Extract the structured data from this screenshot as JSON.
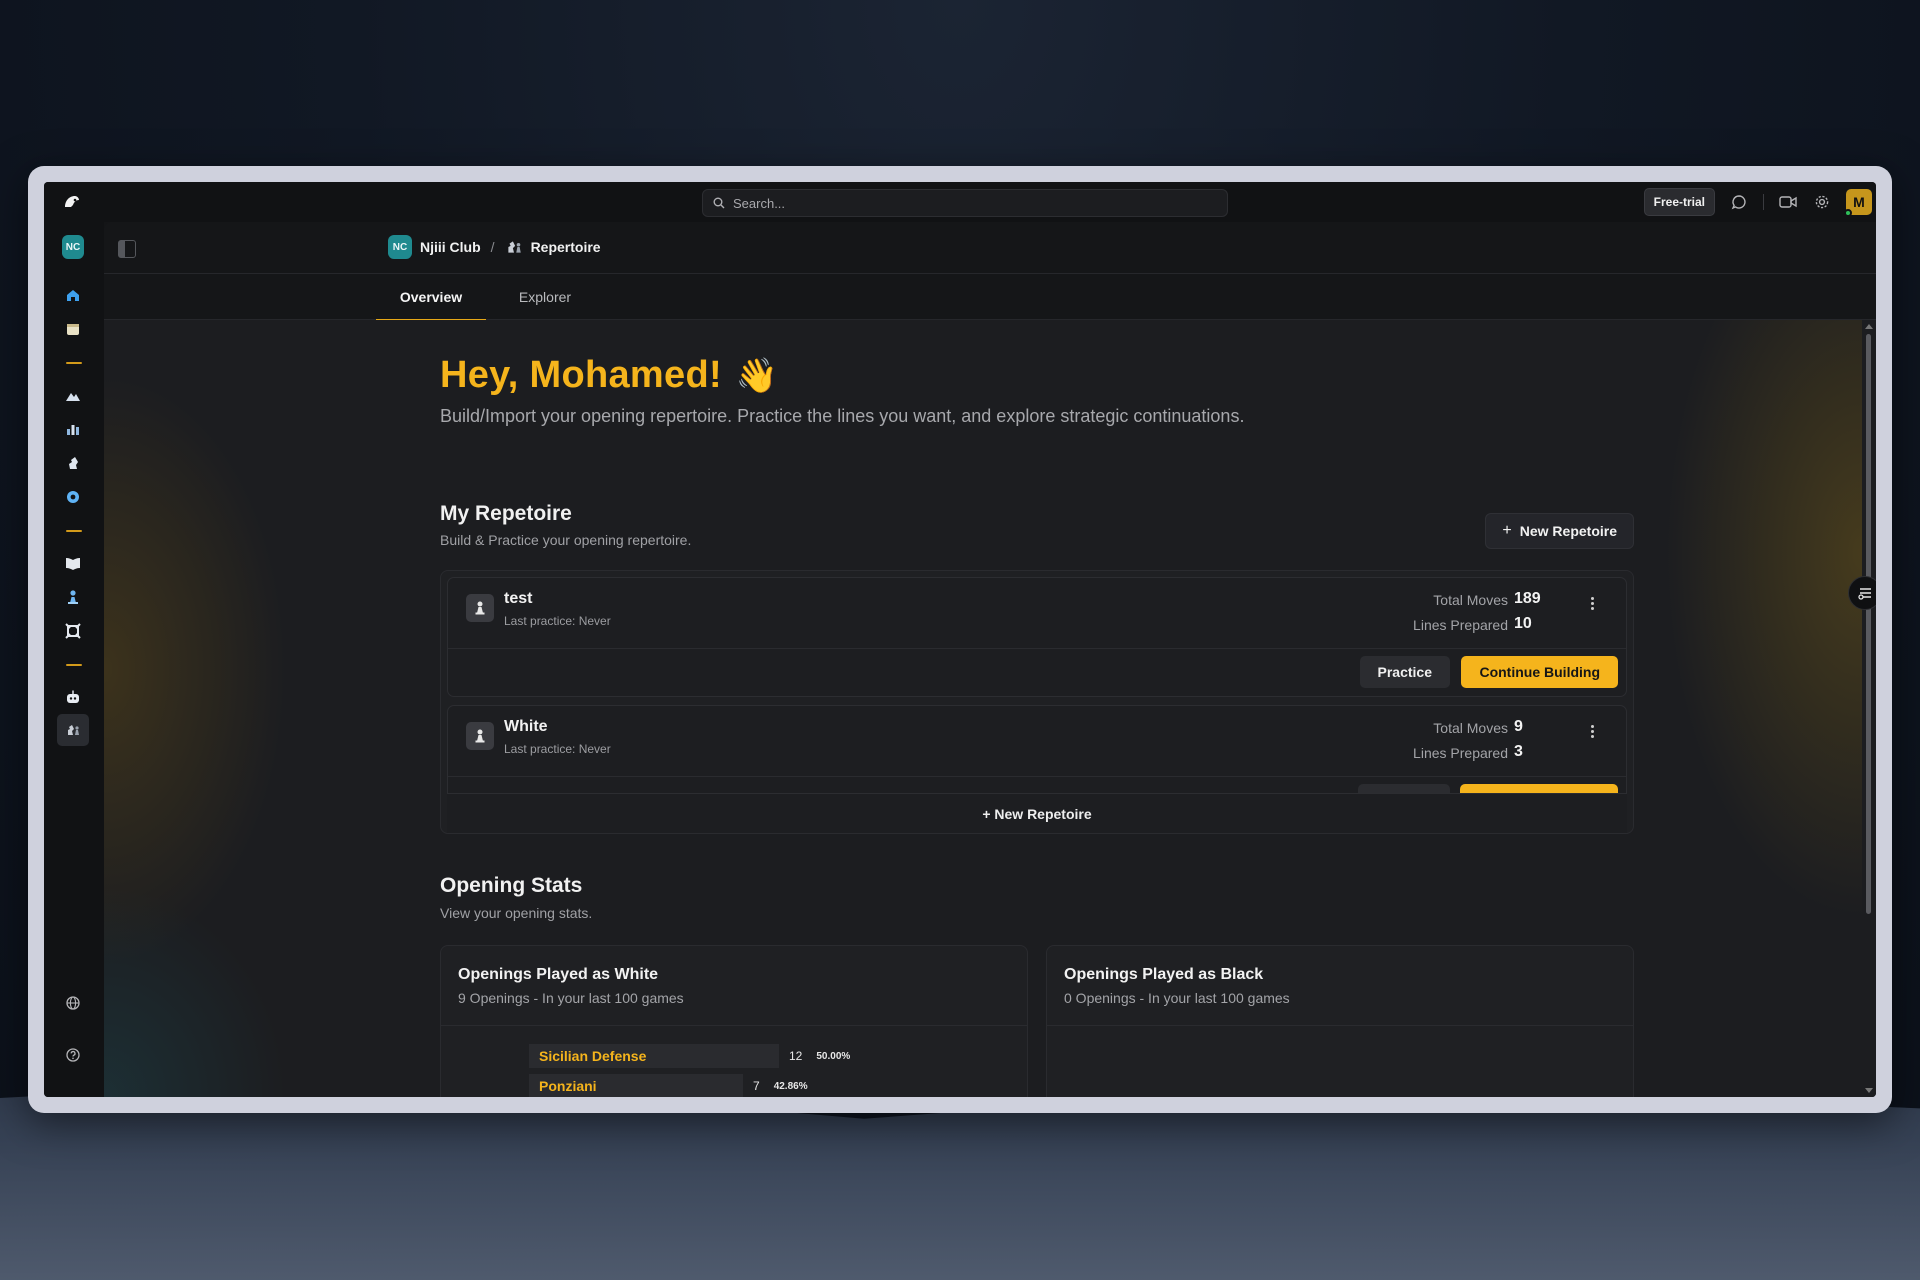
{
  "topbar": {
    "search_placeholder": "Search...",
    "free_trial": "Free-trial",
    "avatar_initial": "M"
  },
  "rail": {
    "club_badge": "NC"
  },
  "breadcrumb": {
    "club_badge": "NC",
    "club_name": "Njiii Club",
    "separator": "/",
    "page": "Repertoire"
  },
  "tabs": [
    {
      "label": "Overview",
      "active": true
    },
    {
      "label": "Explorer",
      "active": false
    }
  ],
  "hero": {
    "greeting": "Hey, Mohamed!",
    "emoji": "👋",
    "subtitle": "Build/Import your opening repertoire. Practice the lines you want, and explore strategic continuations."
  },
  "my_repertoire": {
    "title": "My Repetoire",
    "subtitle": "Build & Practice your opening repertoire.",
    "new_button": "New Repetoire",
    "footer_button": "+ New Repetoire",
    "items": [
      {
        "name": "test",
        "last_practice": "Last practice: Never",
        "total_moves_label": "Total Moves",
        "total_moves": "189",
        "lines_label": "Lines Prepared",
        "lines": "10",
        "practice_label": "Practice",
        "continue_label": "Continue Building"
      },
      {
        "name": "White",
        "last_practice": "Last practice: Never",
        "total_moves_label": "Total Moves",
        "total_moves": "9",
        "lines_label": "Lines Prepared",
        "lines": "3"
      }
    ]
  },
  "opening_stats": {
    "title": "Opening Stats",
    "subtitle": "View your opening stats.",
    "white": {
      "title": "Openings Played as White",
      "subtitle": "9 Openings - In your last 100 games",
      "rows": [
        {
          "name": "Sicilian Defense",
          "count": "12",
          "percent": "50.00%",
          "share": 0.5
        },
        {
          "name": "Ponziani",
          "count": "7",
          "percent": "42.86%",
          "share": 0.4286
        }
      ]
    },
    "black": {
      "title": "Openings Played as Black",
      "subtitle": "0 Openings - In your last 100 games"
    }
  },
  "colors": {
    "accent": "#f5b41c",
    "club_teal": "#1f8a8f"
  }
}
